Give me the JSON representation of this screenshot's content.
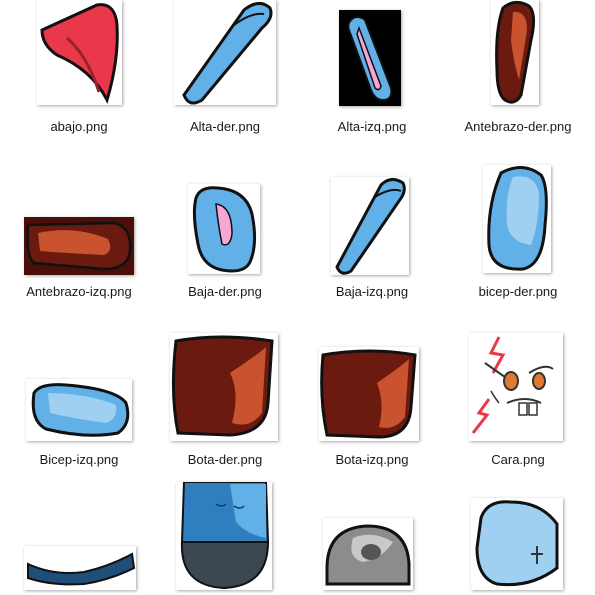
{
  "files": [
    {
      "name": "abajo.png"
    },
    {
      "name": "Alta-der.png"
    },
    {
      "name": "Alta-izq.png"
    },
    {
      "name": "Antebrazo-der.png"
    },
    {
      "name": "Antebrazo-izq.png"
    },
    {
      "name": "Baja-der.png"
    },
    {
      "name": "Baja-izq.png"
    },
    {
      "name": "bicep-der.png"
    },
    {
      "name": "Bicep-izq.png"
    },
    {
      "name": "Bota-der.png"
    },
    {
      "name": "Bota-izq.png"
    },
    {
      "name": "Cara.png"
    },
    {
      "name": ""
    },
    {
      "name": ""
    },
    {
      "name": ""
    },
    {
      "name": ""
    }
  ],
  "colors": {
    "red": "#e8384a",
    "blue": "#62b0e8",
    "light_blue": "#9fd0f2",
    "pink": "#f7a6d6",
    "dark_red": "#6b1a10",
    "orange": "#c8532e",
    "navy": "#1f4e78",
    "grey": "#8c8c8c"
  }
}
